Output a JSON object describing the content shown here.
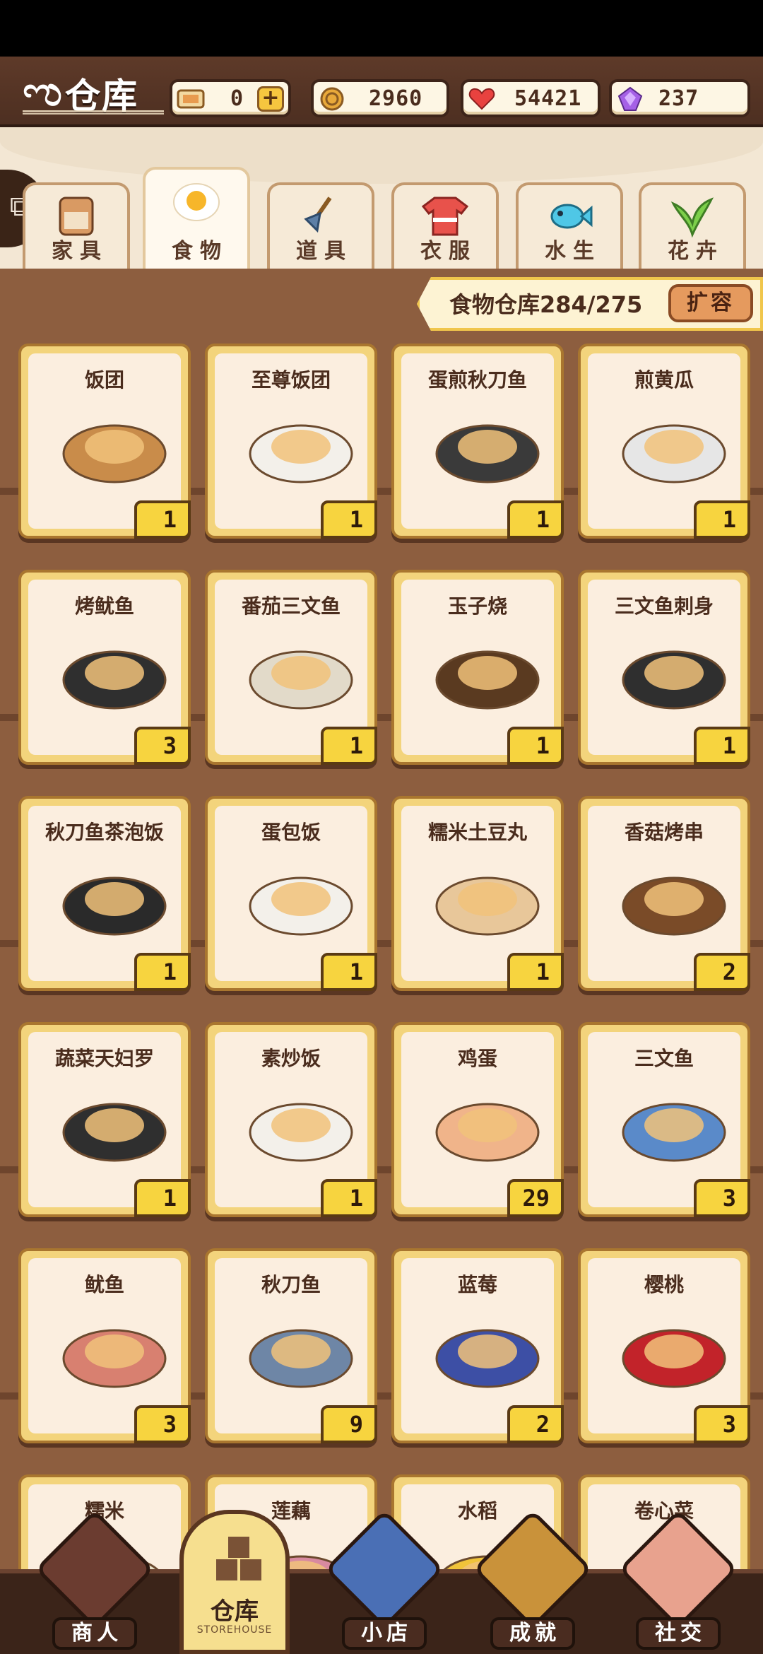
{
  "header": {
    "title": "仓库",
    "resources": [
      {
        "name": "ticket",
        "icon": "ticket-icon",
        "value": "0",
        "has_plus": true
      },
      {
        "name": "coin",
        "icon": "coin-icon",
        "value": "2960"
      },
      {
        "name": "heart",
        "icon": "heart-icon",
        "value": "54421"
      },
      {
        "name": "gem",
        "icon": "gem-icon",
        "value": "237"
      }
    ]
  },
  "tabs": [
    {
      "label": "家具",
      "icon": "cabinet-icon",
      "active": false
    },
    {
      "label": "食物",
      "icon": "fried-egg-icon",
      "active": true
    },
    {
      "label": "道具",
      "icon": "shovel-icon",
      "active": false
    },
    {
      "label": "衣服",
      "icon": "shirt-icon",
      "active": false
    },
    {
      "label": "水生",
      "icon": "fish-icon",
      "active": false
    },
    {
      "label": "花卉",
      "icon": "plant-icon",
      "active": false
    }
  ],
  "storage": {
    "capacity_text": "食物仓库284/275",
    "expand_label": "扩容"
  },
  "items": [
    {
      "name": "饭团",
      "count": "1"
    },
    {
      "name": "至尊饭团",
      "count": "1"
    },
    {
      "name": "蛋煎秋刀鱼",
      "count": "1"
    },
    {
      "name": "煎黄瓜",
      "count": "1"
    },
    {
      "name": "烤鱿鱼",
      "count": "3"
    },
    {
      "name": "番茄三文鱼",
      "count": "1"
    },
    {
      "name": "玉子烧",
      "count": "1"
    },
    {
      "name": "三文鱼刺身",
      "count": "1"
    },
    {
      "name": "秋刀鱼茶泡饭",
      "count": "1"
    },
    {
      "name": "蛋包饭",
      "count": "1"
    },
    {
      "name": "糯米土豆丸",
      "count": "1"
    },
    {
      "name": "香菇烤串",
      "count": "2"
    },
    {
      "name": "蔬菜天妇罗",
      "count": "1"
    },
    {
      "name": "素炒饭",
      "count": "1"
    },
    {
      "name": "鸡蛋",
      "count": "29"
    },
    {
      "name": "三文鱼",
      "count": "3"
    },
    {
      "name": "鱿鱼",
      "count": "3"
    },
    {
      "name": "秋刀鱼",
      "count": "9"
    },
    {
      "name": "蓝莓",
      "count": "2"
    },
    {
      "name": "樱桃",
      "count": "3"
    },
    {
      "name": "糯米",
      "count": ""
    },
    {
      "name": "莲藕",
      "count": ""
    },
    {
      "name": "水稻",
      "count": ""
    },
    {
      "name": "卷心菜",
      "count": ""
    }
  ],
  "nav": {
    "merchant": "商人",
    "storehouse": "仓库",
    "storehouse_sub": "STOREHOUSE",
    "shop": "小店",
    "achievement": "成就",
    "social": "社交"
  }
}
